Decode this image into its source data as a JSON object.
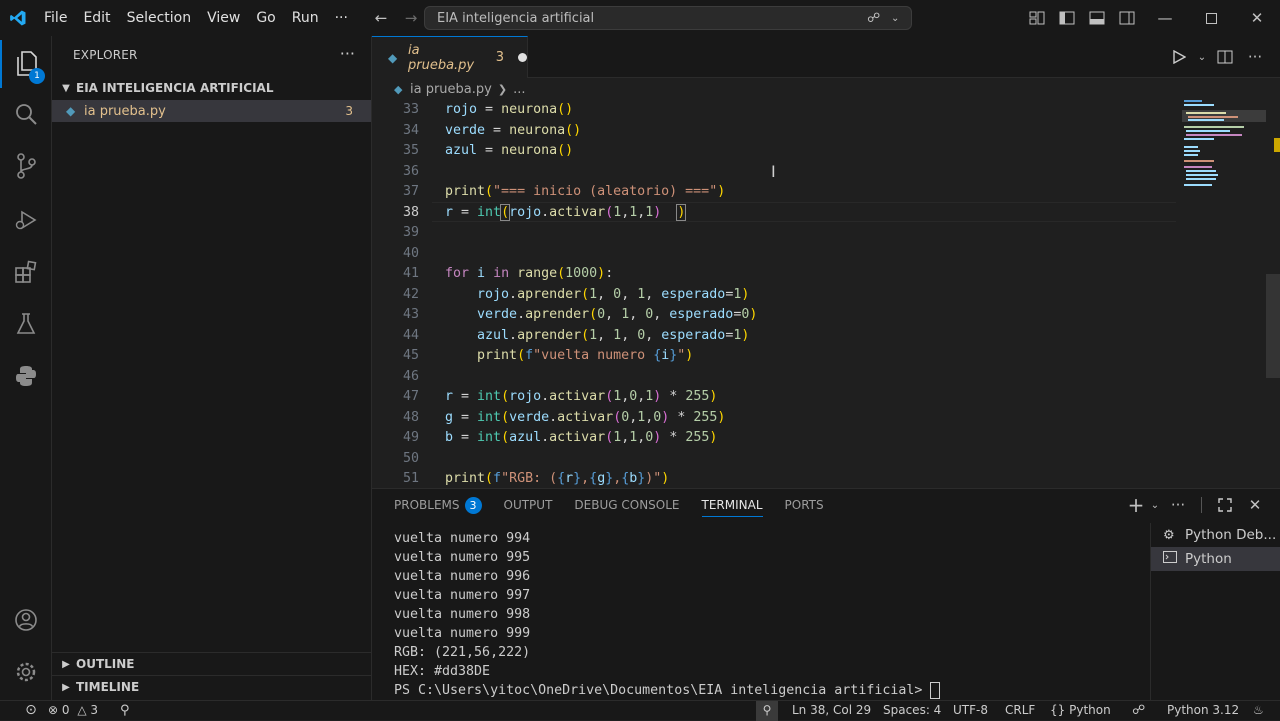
{
  "titlebar": {
    "menu": [
      "File",
      "Edit",
      "Selection",
      "View",
      "Go",
      "Run"
    ],
    "more": "···",
    "command_center": "EIA inteligencia artificial"
  },
  "activity": {
    "explorer_badge": "1"
  },
  "sidebar": {
    "header": "EXPLORER",
    "more": "···",
    "folder": "EIA INTELIGENCIA ARTIFICIAL",
    "file": {
      "name": "ia prueba.py",
      "problems": "3"
    },
    "outline": "OUTLINE",
    "timeline": "TIMELINE"
  },
  "editor": {
    "tab": {
      "name": "ia prueba.py",
      "problems": "3"
    },
    "breadcrumb": {
      "file": "ia prueba.py",
      "rest": "..."
    },
    "line_numbers": [
      "33",
      "34",
      "35",
      "36",
      "37",
      "38",
      "39",
      "40",
      "41",
      "42",
      "43",
      "44",
      "45",
      "46",
      "47",
      "48",
      "49",
      "50",
      "51"
    ]
  },
  "panel": {
    "tabs": {
      "problems": "PROBLEMS",
      "problems_count": "3",
      "output": "OUTPUT",
      "debug": "DEBUG CONSOLE",
      "terminal": "TERMINAL",
      "ports": "PORTS"
    },
    "terminal_lines": [
      "vuelta numero 994",
      "vuelta numero 995",
      "vuelta numero 996",
      "vuelta numero 997",
      "vuelta numero 998",
      "vuelta numero 999",
      "RGB: (221,56,222)",
      "HEX: #dd38DE"
    ],
    "prompt": "PS C:\\Users\\yitoc\\OneDrive\\Documentos\\EIA inteligencia artificial> ",
    "terminals": [
      "Python Deb...",
      "Python"
    ]
  },
  "statusbar": {
    "errors": "0",
    "warnings": "3",
    "position": "Ln 38, Col 29",
    "spaces": "Spaces: 4",
    "encoding": "UTF-8",
    "eol": "CRLF",
    "language_braces": "{}",
    "language": "Python",
    "interpreter": "Python 3.12"
  },
  "colors": {
    "accent": "#0078d4",
    "modified_file": "#e2c08d"
  }
}
